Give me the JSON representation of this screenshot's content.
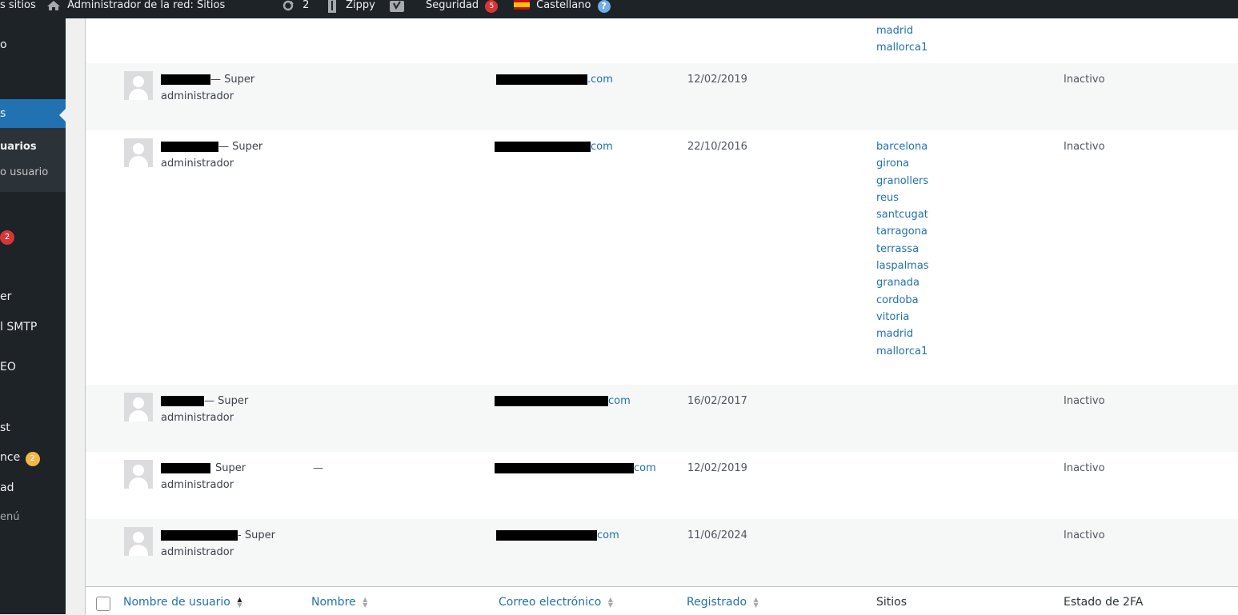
{
  "adminbar": {
    "my_sites": "s sitios",
    "network_admin": "Administrador de la red: Sitios",
    "updates_count": "2",
    "zippy": "Zippy",
    "security": "Seguridad",
    "security_count": "5",
    "language": "Castellano",
    "help": "?"
  },
  "sidebar": {
    "item_o": "o",
    "item_s": "s",
    "sub_users": "uarios",
    "sub_new_user": "o usuario",
    "badge_plugins": "2",
    "item_er": "er",
    "item_smtp": "l SMTP",
    "item_eo": "EO",
    "item_st": "st",
    "item_nce": "nce",
    "badge_nce": "2",
    "item_ad": "ad",
    "item_menu": "enú"
  },
  "top_row": {
    "sites": [
      "madrid",
      "mallorca1"
    ]
  },
  "rows": [
    {
      "role": "— Super administrador",
      "email_suffix": ".com",
      "date": "12/02/2019",
      "sites": [],
      "status": "Inactivo"
    },
    {
      "role": "— Super administrador",
      "email_suffix": "com",
      "date": "22/10/2016",
      "sites": [
        "barcelona",
        "girona",
        "granollers",
        "reus",
        "santcugat",
        "tarragona",
        "terrassa",
        "laspalmas",
        "granada",
        "cordoba",
        "vitoria",
        "madrid",
        "mallorca1"
      ],
      "status": "Inactivo"
    },
    {
      "role": "— Super administrador",
      "email_suffix": "com",
      "date": "16/02/2017",
      "sites": [],
      "status": "Inactivo"
    },
    {
      "role": "Super administrador",
      "name": "—",
      "email_suffix": "com",
      "date": "12/02/2019",
      "sites": [],
      "status": "Inactivo"
    },
    {
      "role": "- Super administrador",
      "email_suffix": "com",
      "date": "11/06/2024",
      "sites": [],
      "status": "Inactivo"
    }
  ],
  "columns": {
    "username": "Nombre de usuario",
    "name": "Nombre",
    "email": "Correo electrónico",
    "registered": "Registrado",
    "sites": "Sitios",
    "twofa": "Estado de 2FA"
  },
  "colors": {
    "accent": "#2271b1",
    "adminbar": "#1d2327",
    "badge_red": "#d63638",
    "badge_orange": "#f0b849"
  }
}
